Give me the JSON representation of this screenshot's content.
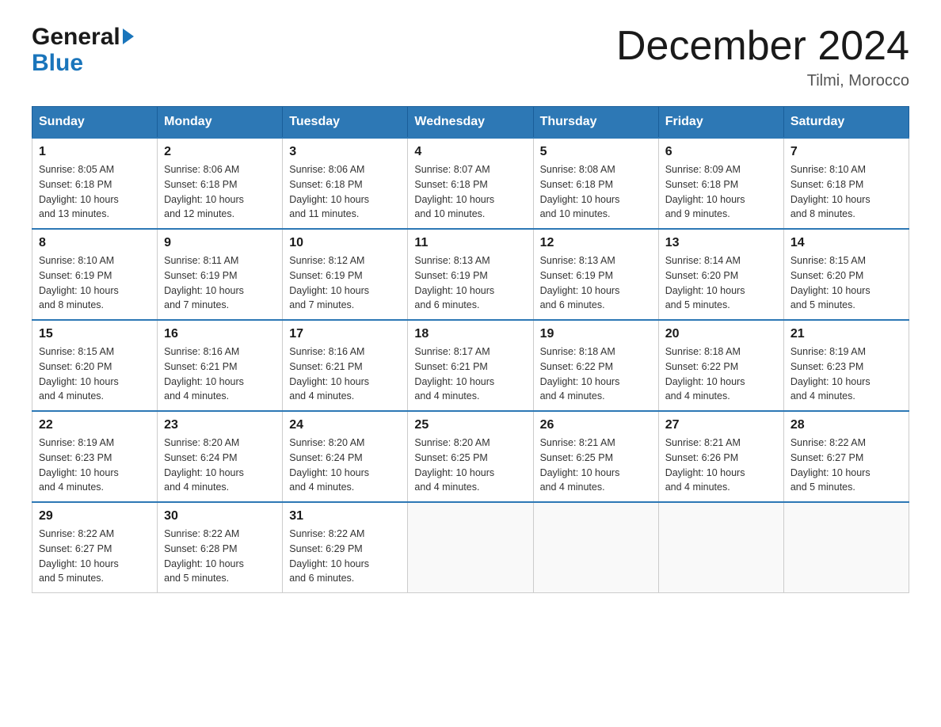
{
  "header": {
    "logo_general": "General",
    "logo_blue": "Blue",
    "month_title": "December 2024",
    "location": "Tilmi, Morocco"
  },
  "calendar": {
    "days_of_week": [
      "Sunday",
      "Monday",
      "Tuesday",
      "Wednesday",
      "Thursday",
      "Friday",
      "Saturday"
    ],
    "weeks": [
      [
        {
          "day": "1",
          "sunrise": "8:05 AM",
          "sunset": "6:18 PM",
          "daylight": "10 hours and 13 minutes."
        },
        {
          "day": "2",
          "sunrise": "8:06 AM",
          "sunset": "6:18 PM",
          "daylight": "10 hours and 12 minutes."
        },
        {
          "day": "3",
          "sunrise": "8:06 AM",
          "sunset": "6:18 PM",
          "daylight": "10 hours and 11 minutes."
        },
        {
          "day": "4",
          "sunrise": "8:07 AM",
          "sunset": "6:18 PM",
          "daylight": "10 hours and 10 minutes."
        },
        {
          "day": "5",
          "sunrise": "8:08 AM",
          "sunset": "6:18 PM",
          "daylight": "10 hours and 10 minutes."
        },
        {
          "day": "6",
          "sunrise": "8:09 AM",
          "sunset": "6:18 PM",
          "daylight": "10 hours and 9 minutes."
        },
        {
          "day": "7",
          "sunrise": "8:10 AM",
          "sunset": "6:18 PM",
          "daylight": "10 hours and 8 minutes."
        }
      ],
      [
        {
          "day": "8",
          "sunrise": "8:10 AM",
          "sunset": "6:19 PM",
          "daylight": "10 hours and 8 minutes."
        },
        {
          "day": "9",
          "sunrise": "8:11 AM",
          "sunset": "6:19 PM",
          "daylight": "10 hours and 7 minutes."
        },
        {
          "day": "10",
          "sunrise": "8:12 AM",
          "sunset": "6:19 PM",
          "daylight": "10 hours and 7 minutes."
        },
        {
          "day": "11",
          "sunrise": "8:13 AM",
          "sunset": "6:19 PM",
          "daylight": "10 hours and 6 minutes."
        },
        {
          "day": "12",
          "sunrise": "8:13 AM",
          "sunset": "6:19 PM",
          "daylight": "10 hours and 6 minutes."
        },
        {
          "day": "13",
          "sunrise": "8:14 AM",
          "sunset": "6:20 PM",
          "daylight": "10 hours and 5 minutes."
        },
        {
          "day": "14",
          "sunrise": "8:15 AM",
          "sunset": "6:20 PM",
          "daylight": "10 hours and 5 minutes."
        }
      ],
      [
        {
          "day": "15",
          "sunrise": "8:15 AM",
          "sunset": "6:20 PM",
          "daylight": "10 hours and 4 minutes."
        },
        {
          "day": "16",
          "sunrise": "8:16 AM",
          "sunset": "6:21 PM",
          "daylight": "10 hours and 4 minutes."
        },
        {
          "day": "17",
          "sunrise": "8:16 AM",
          "sunset": "6:21 PM",
          "daylight": "10 hours and 4 minutes."
        },
        {
          "day": "18",
          "sunrise": "8:17 AM",
          "sunset": "6:21 PM",
          "daylight": "10 hours and 4 minutes."
        },
        {
          "day": "19",
          "sunrise": "8:18 AM",
          "sunset": "6:22 PM",
          "daylight": "10 hours and 4 minutes."
        },
        {
          "day": "20",
          "sunrise": "8:18 AM",
          "sunset": "6:22 PM",
          "daylight": "10 hours and 4 minutes."
        },
        {
          "day": "21",
          "sunrise": "8:19 AM",
          "sunset": "6:23 PM",
          "daylight": "10 hours and 4 minutes."
        }
      ],
      [
        {
          "day": "22",
          "sunrise": "8:19 AM",
          "sunset": "6:23 PM",
          "daylight": "10 hours and 4 minutes."
        },
        {
          "day": "23",
          "sunrise": "8:20 AM",
          "sunset": "6:24 PM",
          "daylight": "10 hours and 4 minutes."
        },
        {
          "day": "24",
          "sunrise": "8:20 AM",
          "sunset": "6:24 PM",
          "daylight": "10 hours and 4 minutes."
        },
        {
          "day": "25",
          "sunrise": "8:20 AM",
          "sunset": "6:25 PM",
          "daylight": "10 hours and 4 minutes."
        },
        {
          "day": "26",
          "sunrise": "8:21 AM",
          "sunset": "6:25 PM",
          "daylight": "10 hours and 4 minutes."
        },
        {
          "day": "27",
          "sunrise": "8:21 AM",
          "sunset": "6:26 PM",
          "daylight": "10 hours and 4 minutes."
        },
        {
          "day": "28",
          "sunrise": "8:22 AM",
          "sunset": "6:27 PM",
          "daylight": "10 hours and 5 minutes."
        }
      ],
      [
        {
          "day": "29",
          "sunrise": "8:22 AM",
          "sunset": "6:27 PM",
          "daylight": "10 hours and 5 minutes."
        },
        {
          "day": "30",
          "sunrise": "8:22 AM",
          "sunset": "6:28 PM",
          "daylight": "10 hours and 5 minutes."
        },
        {
          "day": "31",
          "sunrise": "8:22 AM",
          "sunset": "6:29 PM",
          "daylight": "10 hours and 6 minutes."
        },
        null,
        null,
        null,
        null
      ]
    ]
  },
  "labels": {
    "sunrise": "Sunrise:",
    "sunset": "Sunset:",
    "daylight": "Daylight:"
  }
}
